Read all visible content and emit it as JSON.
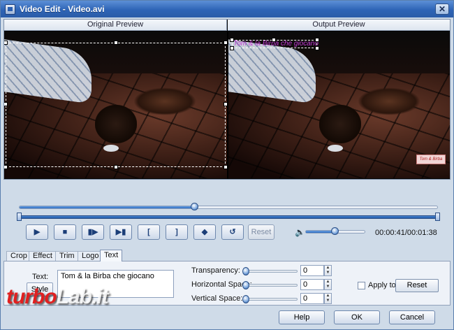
{
  "window": {
    "title": "Video Edit - Video.avi",
    "close_glyph": "✕"
  },
  "preview": {
    "original_label": "Original Preview",
    "output_label": "Output Preview",
    "overlay_text": "Tom & la Birba che giocano",
    "logo_text": "Tom & Birba"
  },
  "timeline": {
    "seek_fraction": 0.42,
    "range_start_fraction": 0.0,
    "range_end_fraction": 1.0
  },
  "controls": {
    "play": "▶",
    "stop": "■",
    "step": "▮▶",
    "next": "▶▮",
    "mark_in": "[",
    "mark_out": "]",
    "snapshot": "◆",
    "rotate": "↺",
    "reset": "Reset",
    "volume_icon": "🔈",
    "volume_fraction": 0.5,
    "time": "00:00:41/00:01:38"
  },
  "tabs": [
    {
      "label": "Crop"
    },
    {
      "label": "Effect"
    },
    {
      "label": "Trim"
    },
    {
      "label": "Logo"
    },
    {
      "label": "Text"
    }
  ],
  "text_panel": {
    "text_label": "Text:",
    "text_value": "Tom & la Birba che giocano",
    "style_button": "Style",
    "transparency_label": "Transparency:",
    "transparency_value": "0",
    "hspace_label": "Horizontal Space:",
    "hspace_value": "0",
    "vspace_label": "Vertical Space:",
    "vspace_value": "0",
    "apply_all_label": "Apply to All",
    "reset_button": "Reset"
  },
  "footer": {
    "help": "Help",
    "ok": "OK",
    "cancel": "Cancel"
  },
  "watermark": {
    "prefix": "turbo",
    "suffix": "Lab.it"
  }
}
